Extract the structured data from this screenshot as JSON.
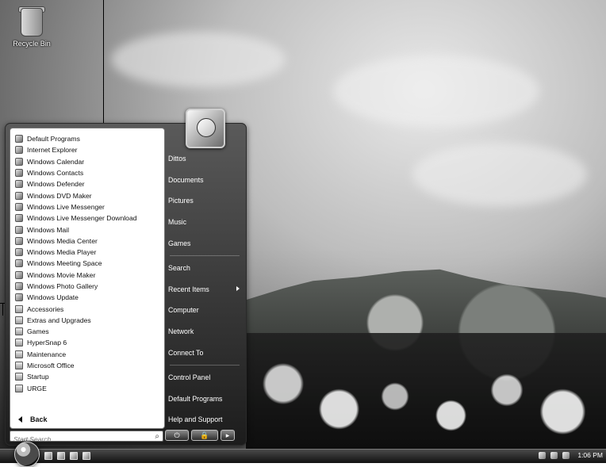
{
  "desktop": {
    "recycle_bin_label": "Recycle Bin"
  },
  "start_menu": {
    "program_list": [
      {
        "label": "Default Programs",
        "icon": "default-programs-icon"
      },
      {
        "label": "Internet Explorer",
        "icon": "internet-explorer-icon"
      },
      {
        "label": "Windows Calendar",
        "icon": "calendar-icon"
      },
      {
        "label": "Windows Contacts",
        "icon": "contacts-icon"
      },
      {
        "label": "Windows Defender",
        "icon": "defender-icon"
      },
      {
        "label": "Windows DVD Maker",
        "icon": "dvd-maker-icon"
      },
      {
        "label": "Windows Live Messenger",
        "icon": "messenger-icon"
      },
      {
        "label": "Windows Live Messenger Download",
        "icon": "messenger-download-icon"
      },
      {
        "label": "Windows Mail",
        "icon": "mail-icon"
      },
      {
        "label": "Windows Media Center",
        "icon": "media-center-icon"
      },
      {
        "label": "Windows Media Player",
        "icon": "media-player-icon"
      },
      {
        "label": "Windows Meeting Space",
        "icon": "meeting-space-icon"
      },
      {
        "label": "Windows Movie Maker",
        "icon": "movie-maker-icon"
      },
      {
        "label": "Windows Photo Gallery",
        "icon": "photo-gallery-icon"
      },
      {
        "label": "Windows Update",
        "icon": "windows-update-icon"
      },
      {
        "label": "Accessories",
        "icon": "folder-icon"
      },
      {
        "label": "Extras and Upgrades",
        "icon": "folder-icon"
      },
      {
        "label": "Games",
        "icon": "folder-icon"
      },
      {
        "label": "HyperSnap 6",
        "icon": "folder-icon"
      },
      {
        "label": "Maintenance",
        "icon": "folder-icon"
      },
      {
        "label": "Microsoft Office",
        "icon": "folder-icon"
      },
      {
        "label": "Startup",
        "icon": "folder-icon"
      },
      {
        "label": "URGE",
        "icon": "folder-icon"
      }
    ],
    "back_label": "Back",
    "search_placeholder": "Start Search",
    "right_items": [
      {
        "label": "Dittos"
      },
      {
        "label": "Documents"
      },
      {
        "label": "Pictures"
      },
      {
        "label": "Music"
      },
      {
        "label": "Games"
      },
      {
        "label": "Search"
      },
      {
        "label": "Recent Items",
        "has_submenu": true
      },
      {
        "label": "Computer"
      },
      {
        "label": "Network"
      },
      {
        "label": "Connect To"
      },
      {
        "label": "Control Panel"
      },
      {
        "label": "Default Programs"
      },
      {
        "label": "Help and Support"
      }
    ],
    "power_buttons": {
      "power": "⏻",
      "lock": "🔒",
      "more": "▸"
    }
  },
  "taskbar": {
    "clock": "1:06 PM"
  }
}
